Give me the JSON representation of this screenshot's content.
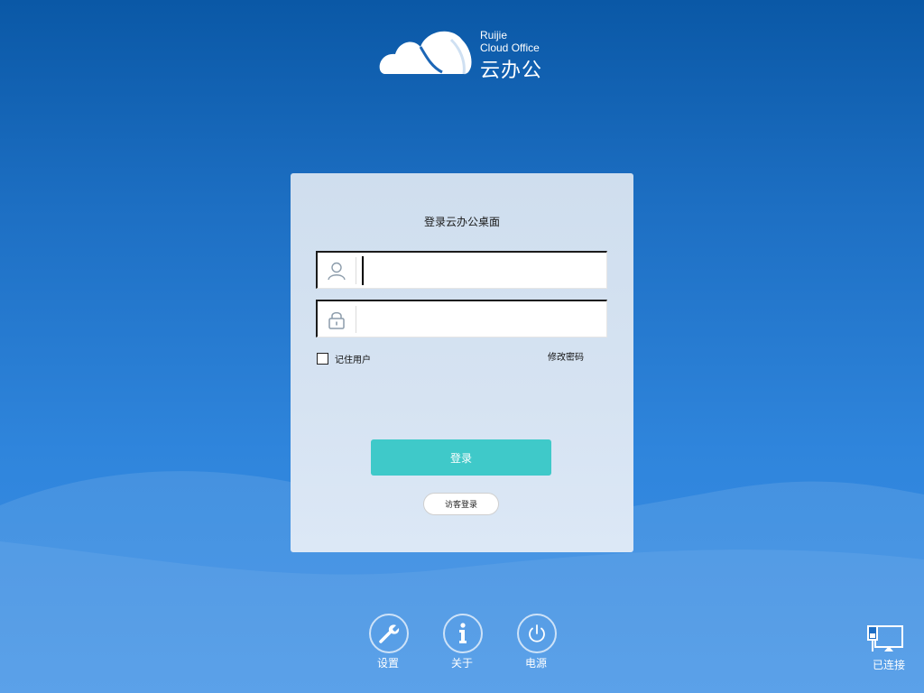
{
  "logo": {
    "brand_en_line1": "Ruijie",
    "brand_en_line2": "Cloud Office",
    "brand_cn": "云办公"
  },
  "login_panel": {
    "title": "登录云办公桌面",
    "username": {
      "value": "",
      "icon": "user-icon"
    },
    "password": {
      "value": "",
      "icon": "lock-icon"
    },
    "remember_user": {
      "label": "记住用户",
      "checked": false
    },
    "change_password_label": "修改密码",
    "login_button": "登录",
    "guest_login_button": "访客登录"
  },
  "bottom_bar": {
    "settings": {
      "label": "设置",
      "icon": "wrench-icon"
    },
    "about": {
      "label": "关于",
      "icon": "info-icon"
    },
    "power": {
      "label": "电源",
      "icon": "power-icon"
    }
  },
  "network_status": {
    "label": "已连接",
    "icon": "network-connected-icon"
  },
  "colors": {
    "background_top": "#0a58a6",
    "background_bottom": "#3b8fe6",
    "panel": "#d6e3f2",
    "login_button": "#3fc9c9"
  }
}
